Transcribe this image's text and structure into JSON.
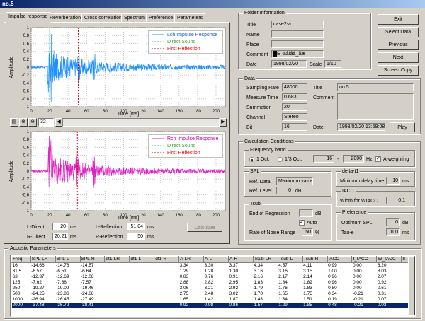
{
  "window": {
    "title": "no.5"
  },
  "tabs": [
    "Impulse response",
    "Reverberation",
    "Cross correlation",
    "Spectrum",
    "Preference",
    "Parameters"
  ],
  "plots": {
    "top": {
      "legend": [
        "Lch Impulse Response",
        "Direct Sound",
        "First Reflection"
      ],
      "trace_color": "#1e90ff"
    },
    "bottom": {
      "legend": [
        "Rch Impulse Response",
        "Direct Sound",
        "First Reflection"
      ],
      "trace_color": "#e020c0"
    },
    "y_ticks": [
      "1",
      "0.8",
      "0.6",
      "0.4",
      "0.2",
      "0",
      "-0.2",
      "-0.4",
      "-0.6",
      "-0.8",
      "-1"
    ],
    "x_ticks": [
      "0",
      "20",
      "40",
      "60",
      "80",
      "100",
      "120",
      "140",
      "160",
      "180",
      "200"
    ],
    "ylabel": "Amplitude",
    "xlabel": "Time [ms]",
    "zoom_value": "32",
    "direct_color": "#40c040",
    "reflection_color": "#e00000"
  },
  "measures": {
    "l_direct_label": "L-Direct",
    "l_direct": "20",
    "l_direct_unit": "ms",
    "r_direct_label": "R-Direct",
    "r_direct": "20.21",
    "r_direct_unit": "ms",
    "l_reflection_label": "L-Reflection",
    "l_reflection": "51.04",
    "l_reflection_unit": "ms",
    "r_reflection_label": "R-Reflection",
    "r_reflection": "50",
    "r_reflection_unit": "ms",
    "calculate": "Calculate"
  },
  "folder": {
    "group": "Folder Information",
    "title_label": "Title",
    "title": "case2-a",
    "name_label": "Name",
    "name": "",
    "place_label": "Place",
    "place": "",
    "comment_label": "Comment",
    "comment": "█É ·áâíâà_ãæ",
    "date_label": "Date",
    "date": "1998/02/20",
    "scale_label": "Scale",
    "scale": "1/10"
  },
  "buttons": {
    "exit": "Exit",
    "select": "Select Data",
    "previous": "Previous",
    "next": "Next",
    "screen_copy": "Screen Copy"
  },
  "data": {
    "group": "Data",
    "sampling_rate_label": "Sampling Rate",
    "sampling_rate": "48000",
    "measure_time_label": "Measure Time",
    "measure_time": "0.683",
    "summation_label": "Summation",
    "summation": "20",
    "channel_label": "Channel",
    "channel": "Stereo",
    "bit_label": "Bit",
    "bit": "16",
    "title_label": "Title",
    "title": "no.5",
    "comment_label": "Comment",
    "comment": "",
    "date_label": "Date",
    "date": "1998/02/20 13:59:08",
    "play": "Play"
  },
  "calc": {
    "group": "Calculation Conditions",
    "freq_group": "Frequency band",
    "oct1": "1 Oct.",
    "oct3": "1/3 Oct.",
    "freq_from": "16",
    "freq_to": "2000",
    "freq_sep": "-",
    "freq_unit": "Hz",
    "a_weighting": "A-weighting",
    "spl_group": "SPL",
    "ref_data_label": "Ref. Data",
    "ref_data": "Maximum value",
    "ref_level_label": "Ref. Level",
    "ref_level": "0",
    "ref_level_unit": "dB",
    "delta_group": "delta-t1",
    "min_delay_label": "Minimum delay time",
    "min_delay": "10",
    "min_delay_unit": "ms",
    "iacc_group": "IACC",
    "wiacc_label": "Width for WIACC",
    "wiacc": "0.1",
    "tsub_group": "Tsub",
    "end_regression_label": "End of Regression",
    "end_regression": "",
    "end_regression_unit": "dB",
    "auto_label": "Auto",
    "noise_range_label": "Rate of Noise Range",
    "noise_range": "50",
    "noise_range_unit": "%",
    "pref_group": "Preference",
    "optimum_spl_label": "Optimum SPL",
    "optimum_spl": "0",
    "optimum_spl_unit": "dB",
    "tau_e_label": "Tau-e",
    "tau_e": "100",
    "tau_e_unit": "ms"
  },
  "acoustic": {
    "group": "Acoustic Parameters",
    "columns": [
      "Freq.",
      "SPL-LR",
      "SPL-L",
      "SPL-R",
      "dt1-LR",
      "dt1-L",
      "dt1-R",
      "A-LR",
      "A-L",
      "A-R",
      "Tsub-LR",
      "Tsub-L",
      "Tsub-R",
      "IACC",
      "t_IACC",
      "W_IACC",
      "S"
    ],
    "rows": [
      [
        "16",
        "-14.66",
        "-14.76",
        "-14.57",
        "",
        "",
        "",
        "3.34",
        "3.30",
        "3.37",
        "4.34",
        "4.57",
        "4.11",
        "0.99",
        "0.00",
        "8.20",
        ""
      ],
      [
        "31.5",
        "-6.57",
        "-6.51",
        "-6.64",
        "",
        "",
        "",
        "1.29",
        "1.28",
        "1.30",
        "3.16",
        "3.16",
        "3.15",
        "1.00",
        "0.00",
        "8.03",
        ""
      ],
      [
        "63",
        "-12.37",
        "-12.69",
        "-12.08",
        "",
        "",
        "",
        "0.83",
        "0.76",
        "0.91",
        "2.16",
        "2.17",
        "2.14",
        "0.96",
        "0.00",
        "2.07",
        ""
      ],
      [
        "125",
        "-7.62",
        "-7.68",
        "-7.57",
        "",
        "",
        "",
        "2.88",
        "2.82",
        "2.95",
        "1.83",
        "1.84",
        "1.82",
        "0.96",
        "0.00",
        "0.92",
        ""
      ],
      [
        "250",
        "-19.27",
        "-19.09",
        "-19.46",
        "",
        "",
        "",
        "3.06",
        "3.21",
        "2.92",
        "1.79",
        "1.76",
        "1.83",
        "0.80",
        "0.00",
        "0.61",
        ""
      ],
      [
        "500",
        "-24.25",
        "-23.86",
        "-24.68",
        "",
        "",
        "",
        "2.75",
        "2.48",
        "3.02",
        "1.70",
        "1.65",
        "1.75",
        "0.34",
        "-0.21",
        "0.31",
        ""
      ],
      [
        "1000",
        "-26.94",
        "-26.45",
        "-27.49",
        "",
        "",
        "",
        "1.65",
        "1.42",
        "1.87",
        "1.43",
        "1.34",
        "1.51",
        "0.19",
        "-0.21",
        "0.07",
        ""
      ],
      [
        "2000",
        "-37.48",
        "-36.72",
        "-38.41",
        "",
        "",
        "",
        "0.92",
        "0.98",
        "0.86",
        "1.57",
        "1.29",
        "1.85",
        "0.48",
        "-0.21",
        "0.03",
        ""
      ]
    ]
  }
}
